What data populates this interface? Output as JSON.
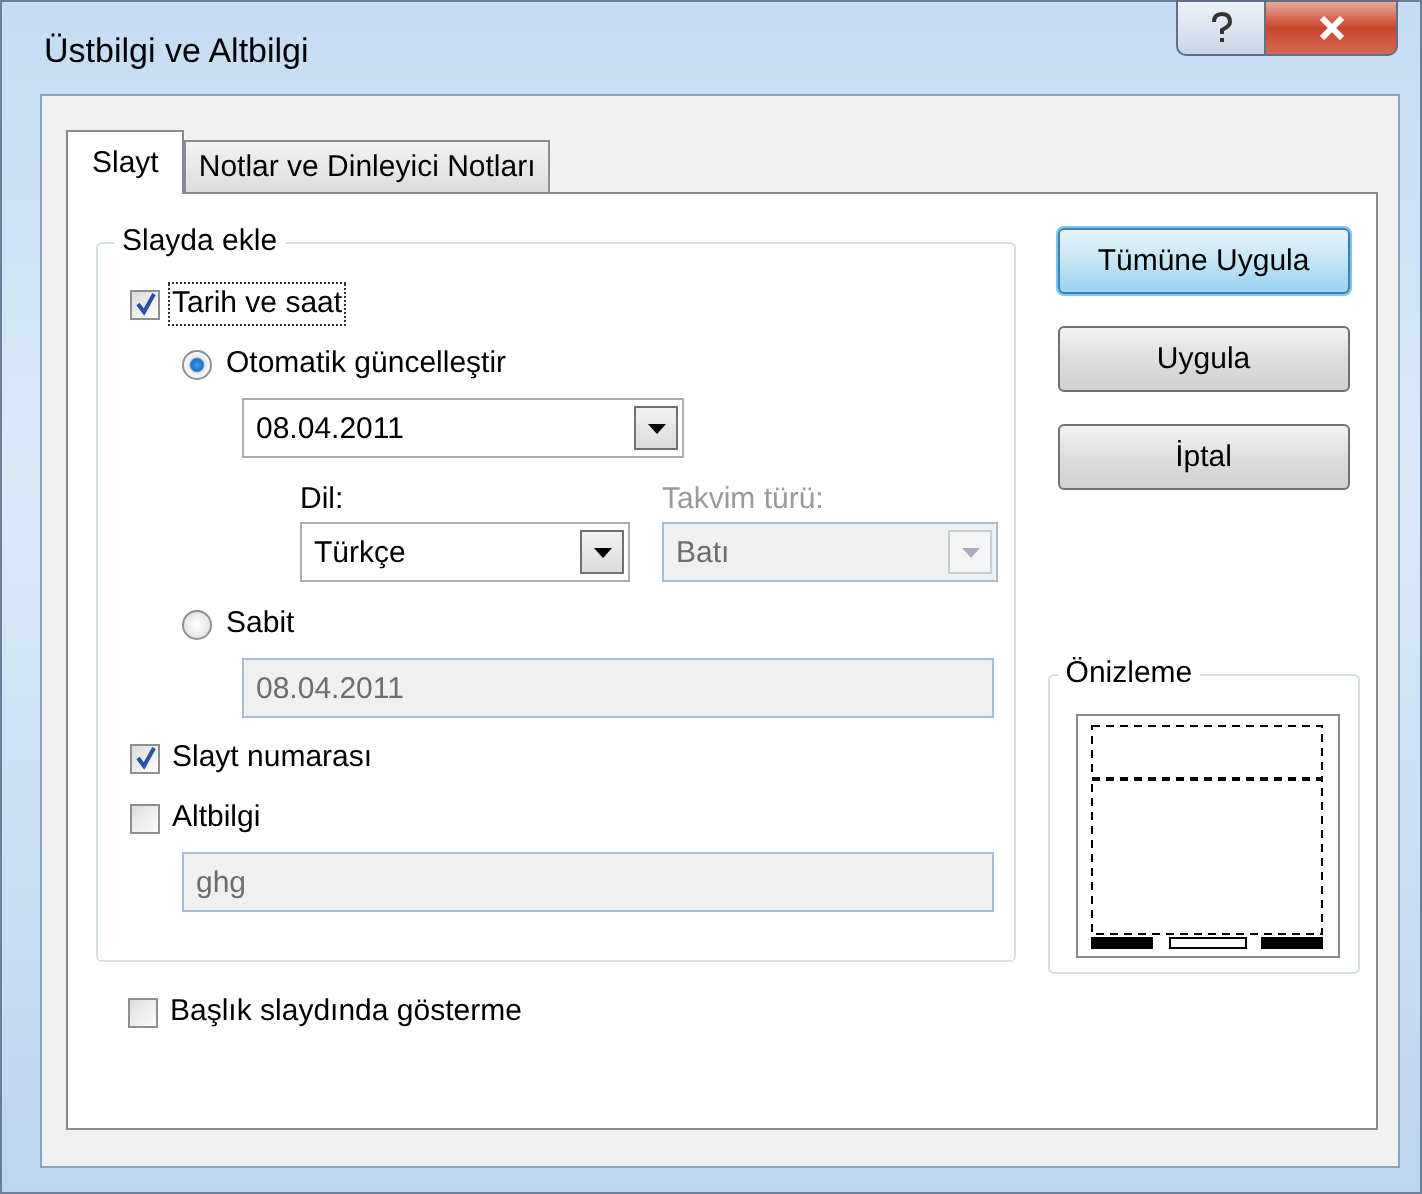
{
  "window": {
    "title": "Üstbilgi ve Altbilgi"
  },
  "tabs": [
    {
      "label": "Slayt",
      "selected": true
    },
    {
      "label": "Notlar ve Dinleyici Notları",
      "selected": false
    }
  ],
  "group": {
    "title": "Slayda ekle",
    "date_time": {
      "label": "Tarih ve saat",
      "checked": true,
      "focused": true
    },
    "auto_update": {
      "label": "Otomatik güncelleştir",
      "selected": true,
      "value": "08.04.2011"
    },
    "language": {
      "label": "Dil:",
      "value": "Türkçe",
      "disabled": false
    },
    "calendar": {
      "label": "Takvim türü:",
      "value": "Batı",
      "disabled": true
    },
    "fixed": {
      "label": "Sabit",
      "selected": false,
      "value": "08.04.2011",
      "disabled": true
    },
    "slide_number": {
      "label": "Slayt numarası",
      "checked": true
    },
    "footer": {
      "label": "Altbilgi",
      "checked": false,
      "value": "ghg",
      "disabled": true
    }
  },
  "hide_on_title": {
    "label": "Başlık slaydında gösterme",
    "checked": false
  },
  "buttons": [
    {
      "label": "Tümüne Uygula",
      "default": true
    },
    {
      "label": "Uygula",
      "default": false
    },
    {
      "label": "İptal",
      "default": false
    }
  ],
  "preview": {
    "title": "Önizleme"
  }
}
